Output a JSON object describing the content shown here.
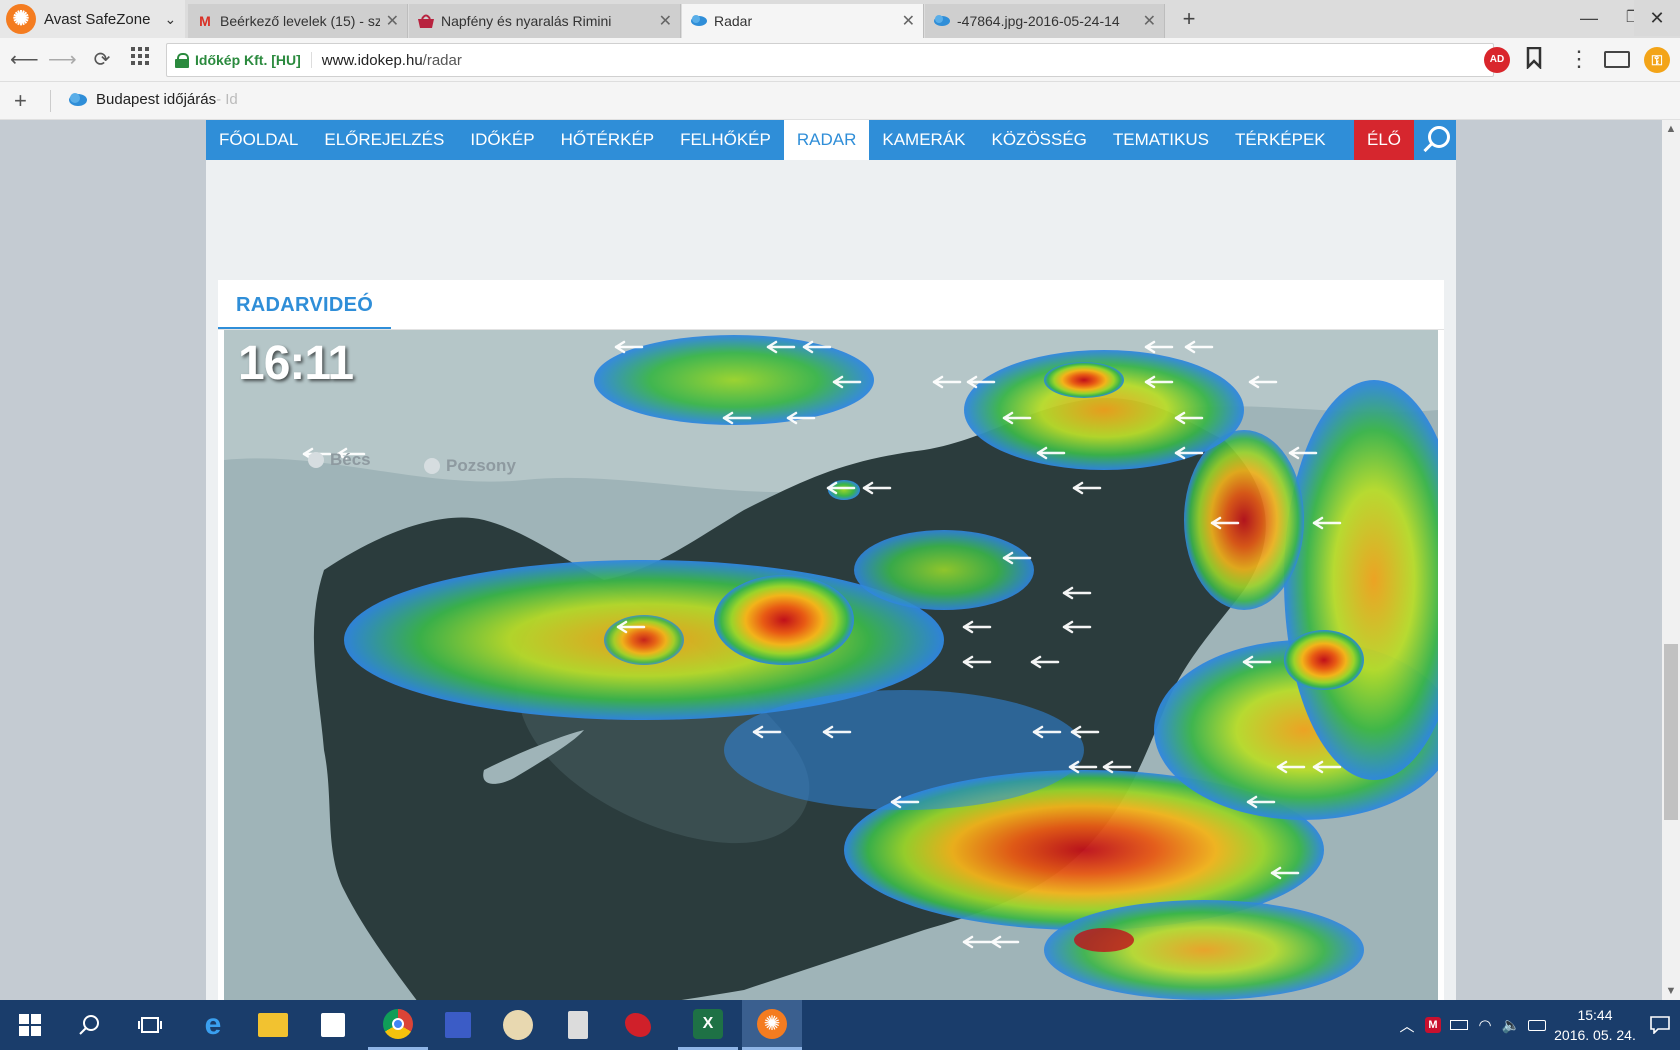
{
  "browser": {
    "brand": "Avast SafeZone",
    "tabs": [
      {
        "title": "Beérkező levelek (15) - szil"
      },
      {
        "title": "Napfény és nyaralás Rimini"
      },
      {
        "title": "Radar"
      },
      {
        "title": "-47864.jpg-2016-05-24-14"
      }
    ],
    "site_identity": "Időkép Kft. [HU]",
    "url_host": "www.idokep.hu",
    "url_path": "/radar",
    "adblock_badge": "AD",
    "bookmark": {
      "label": "Budapest időjárás",
      "faded": " - Id"
    }
  },
  "site": {
    "nav": [
      {
        "label": "FŐOLDAL"
      },
      {
        "label": "ELŐREJELZÉS"
      },
      {
        "label": "IDŐKÉP"
      },
      {
        "label": "HŐTÉRKÉP"
      },
      {
        "label": "FELHŐKÉP"
      },
      {
        "label": "RADAR"
      },
      {
        "label": "KAMERÁK"
      },
      {
        "label": "KÖZÖSSÉG"
      },
      {
        "label": "TEMATIKUS"
      },
      {
        "label": "TÉRKÉPEK"
      }
    ],
    "live_label": "ÉLŐ",
    "section_title": "RADARVIDEÓ",
    "radar_time": "16:11",
    "cities": [
      {
        "name": "Bécs"
      },
      {
        "name": "Pozsony"
      }
    ]
  },
  "taskbar": {
    "clock_time": "15:44",
    "clock_date": "2016. 05. 24."
  },
  "colors": {
    "accent": "#2f8ed8",
    "live": "#d6262e",
    "taskbar": "#1a3d6b"
  }
}
